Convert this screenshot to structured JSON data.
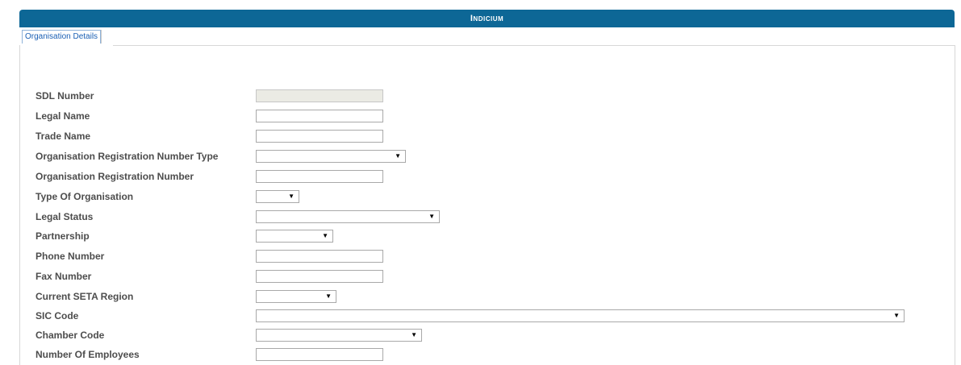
{
  "header": {
    "title": "Indicium"
  },
  "tabs": [
    {
      "label": "Organisation Details"
    }
  ],
  "form": {
    "fields": [
      {
        "label": "SDL Number",
        "value": "",
        "kind": "text",
        "disabled": true
      },
      {
        "label": "Legal Name",
        "value": "",
        "kind": "text"
      },
      {
        "label": "Trade Name",
        "value": "",
        "kind": "text"
      },
      {
        "label": "Organisation Registration Number Type",
        "value": "",
        "kind": "select"
      },
      {
        "label": "Organisation Registration Number",
        "value": "",
        "kind": "text"
      },
      {
        "label": "Type Of Organisation",
        "value": "",
        "kind": "select"
      },
      {
        "label": "Legal Status",
        "value": "",
        "kind": "select"
      },
      {
        "label": "Partnership",
        "value": "",
        "kind": "select"
      },
      {
        "label": "Phone Number",
        "value": "",
        "kind": "text"
      },
      {
        "label": "Fax Number",
        "value": "",
        "kind": "text"
      },
      {
        "label": "Current SETA Region",
        "value": "",
        "kind": "select"
      },
      {
        "label": "SIC Code",
        "value": "",
        "kind": "select"
      },
      {
        "label": "Chamber Code",
        "value": "",
        "kind": "select"
      },
      {
        "label": "Number Of Employees",
        "value": "",
        "kind": "text"
      }
    ]
  },
  "icons": {
    "dropdown": "triangle-down-icon"
  },
  "colors": {
    "header_bg": "#0d6796",
    "tab_text": "#1a5fb4",
    "label_text": "#4d4d4d"
  }
}
